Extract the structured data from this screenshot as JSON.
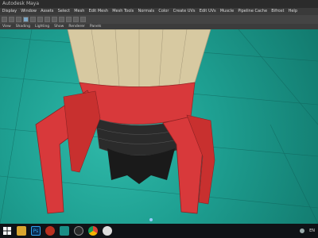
{
  "window": {
    "title": "Autodesk Maya"
  },
  "menubar": {
    "items": [
      "Display",
      "Window",
      "Assets",
      "Select",
      "Mesh",
      "Edit Mesh",
      "Mesh Tools",
      "Normals",
      "Color",
      "Create UVs",
      "Edit UVs",
      "Muscle",
      "Pipeline Cache",
      "Bifrost",
      "Help"
    ]
  },
  "panel_menu": {
    "items": [
      "View",
      "Shading",
      "Lighting",
      "Show",
      "Renderer",
      "Panels"
    ]
  },
  "taskbar": {
    "apps": [
      {
        "icon": "windows-start-icon",
        "label": ""
      },
      {
        "icon": "folder-icon",
        "label": ""
      },
      {
        "icon": "photoshop-icon",
        "label": "Ps"
      },
      {
        "icon": "media-icon",
        "label": ""
      },
      {
        "icon": "maya-icon",
        "label": ""
      },
      {
        "icon": "obs-icon",
        "label": ""
      },
      {
        "icon": "chrome-icon",
        "label": ""
      },
      {
        "icon": "app-icon",
        "label": ""
      }
    ],
    "language": "EN"
  },
  "colors": {
    "viewport": "#1e9f91",
    "rocket_red": "#d8393b",
    "rocket_top": "#d7c9a1",
    "engine": "#2b2b2b"
  }
}
